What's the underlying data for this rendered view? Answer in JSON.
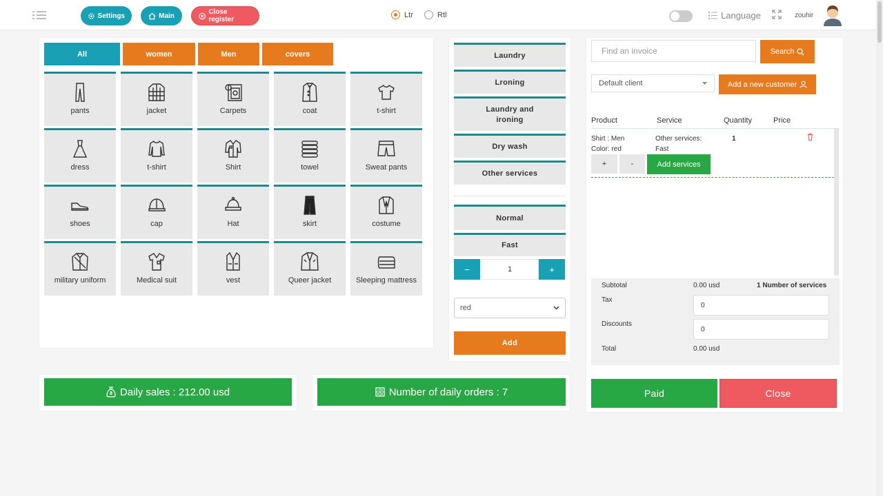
{
  "header": {
    "settings_label": "Settings",
    "main_label": "Main",
    "close_register_label": "Close register",
    "dir_ltr": "Ltr",
    "dir_rtl": "Rtl",
    "language_label": "Language",
    "username": "zouhir"
  },
  "categories": {
    "tabs": [
      "All",
      "women",
      "Men",
      "covers"
    ],
    "items": [
      {
        "label": "pants",
        "icon": "pants-icon"
      },
      {
        "label": "jacket",
        "icon": "jacket-icon"
      },
      {
        "label": "Carpets",
        "icon": "carpet-icon"
      },
      {
        "label": "coat",
        "icon": "coat-icon"
      },
      {
        "label": "t-shirt",
        "icon": "tshirt-icon"
      },
      {
        "label": "dress",
        "icon": "dress-icon"
      },
      {
        "label": "t-shirt",
        "icon": "longsleeve-icon"
      },
      {
        "label": "Shirt",
        "icon": "shirt-icon"
      },
      {
        "label": "towel",
        "icon": "towel-icon"
      },
      {
        "label": "Sweat pants",
        "icon": "shorts-icon"
      },
      {
        "label": "shoes",
        "icon": "shoe-icon"
      },
      {
        "label": "cap",
        "icon": "cap-icon"
      },
      {
        "label": "Hat",
        "icon": "hat-icon"
      },
      {
        "label": "skirt",
        "icon": "skirt-icon"
      },
      {
        "label": "costume",
        "icon": "costume-icon"
      },
      {
        "label": "military uniform",
        "icon": "uniform-icon"
      },
      {
        "label": "Medical suit",
        "icon": "medical-suit-icon"
      },
      {
        "label": "vest",
        "icon": "vest-icon"
      },
      {
        "label": "Queer jacket",
        "icon": "queer-jacket-icon"
      },
      {
        "label": "Sleeping mattress",
        "icon": "mattress-icon"
      }
    ]
  },
  "services": {
    "items": [
      "Laundry",
      "Lroning",
      "Laundry and ironing",
      "Dry wash",
      "Other services"
    ],
    "speeds": [
      "Normal",
      "Fast"
    ],
    "quantity_minus": "−",
    "quantity_value": "1",
    "quantity_plus": "+",
    "color_selected": "red",
    "add_label": "Add"
  },
  "invoice": {
    "search_placeholder": "Find an invoice",
    "search_label": "Search",
    "client_selected": "Default client",
    "add_customer_label": "Add a new customer",
    "columns": [
      "Product",
      "Service",
      "Quantity",
      "Price"
    ],
    "row": {
      "product_line1": "Shirt : Men",
      "product_line2": "Color: red",
      "service_line1": "Other services:",
      "service_line2": "Fast",
      "quantity": "1",
      "plus": "+",
      "minus": "-",
      "add_services_label": "Add services"
    },
    "subtotal_label": "Subtotal",
    "subtotal_value": "0.00 usd",
    "services_count": "1 Number of services",
    "tax_label": "Tax",
    "tax_value": "0",
    "discounts_label": "Discounts",
    "discounts_value": "0",
    "total_label": "Total",
    "total_value": "0.00 usd",
    "paid_label": "Paid",
    "close_label": "Close"
  },
  "stats": {
    "daily_sales": "Daily sales : 212.00 usd",
    "daily_orders": "Number of daily orders : 7"
  },
  "colors": {
    "teal": "#1aa0b4",
    "orange": "#e87a1e",
    "green": "#28a745",
    "red": "#ee5a5f",
    "tile_border": "#1a8a8f"
  }
}
